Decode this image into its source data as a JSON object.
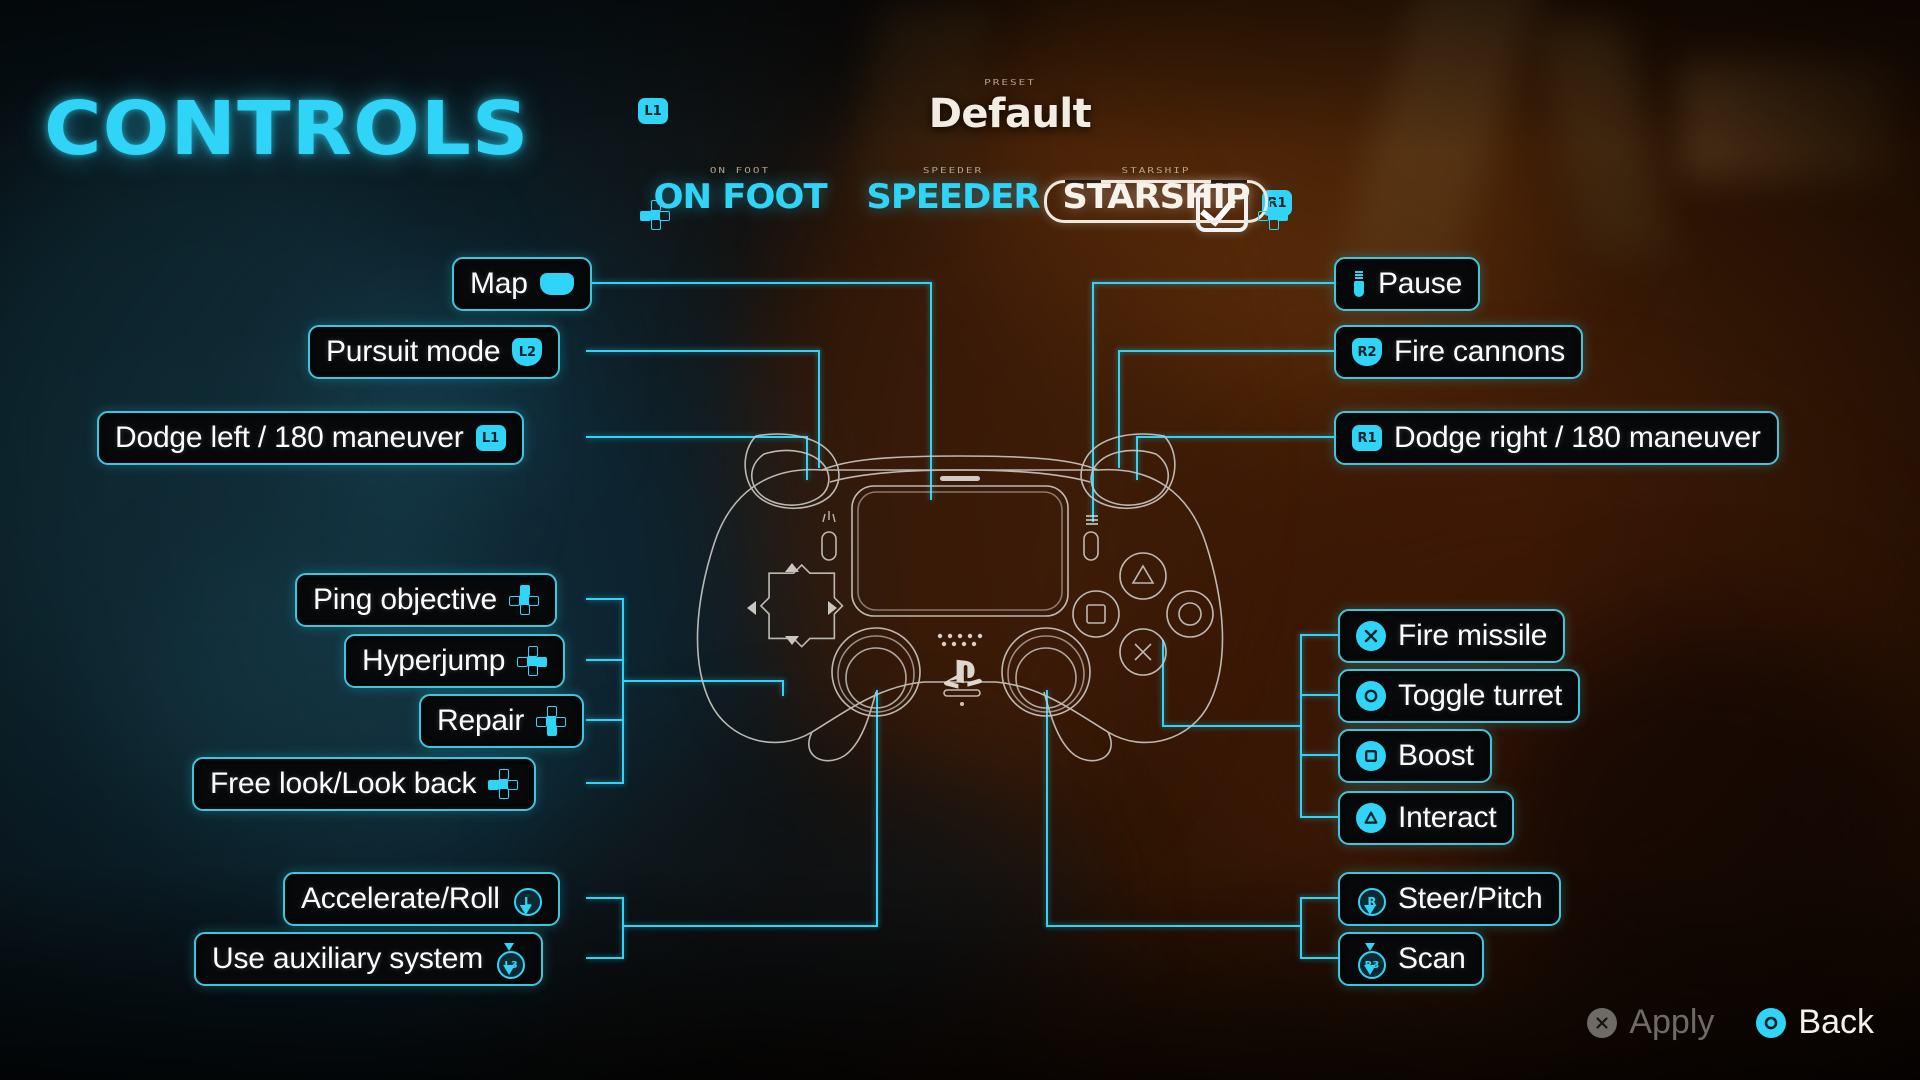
{
  "page": {
    "title": "CONTROLS",
    "accent_color": "#2fd4f7",
    "label_border_color": "#3fc6dd",
    "label_bg_color": "#07090b",
    "text_color": "#ffffff"
  },
  "header": {
    "prev_badge": "L1",
    "next_badge": "R1",
    "preset_caption": "PRESET",
    "preset_name": "Default",
    "confirm_icon": "checkbox-check-icon"
  },
  "tabs": {
    "dpad_left_icon": "dpad-left-icon",
    "dpad_right_icon": "dpad-right-icon",
    "items": [
      {
        "label": "ON FOOT",
        "caption": "ON FOOT",
        "selected": false
      },
      {
        "label": "SPEEDER",
        "caption": "SPEEDER",
        "selected": false
      },
      {
        "label": "STARSHIP",
        "caption": "STARSHIP",
        "selected": true
      }
    ]
  },
  "left_controls": [
    {
      "label": "Map",
      "icon": "touchpad-icon",
      "button": ""
    },
    {
      "label": "Pursuit mode",
      "icon": "trigger-icon",
      "button": "L2"
    },
    {
      "label": "Dodge left / 180 maneuver",
      "icon": "bumper-icon",
      "button": "L1"
    },
    {
      "label": "Ping objective",
      "icon": "dpad-up-icon",
      "button": ""
    },
    {
      "label": "Hyperjump",
      "icon": "dpad-right-icon",
      "button": ""
    },
    {
      "label": "Repair",
      "icon": "dpad-down-icon",
      "button": ""
    },
    {
      "label": "Free look/Look back",
      "icon": "dpad-left-icon",
      "button": ""
    },
    {
      "label": "Accelerate/Roll",
      "icon": "left-stick-icon",
      "button": "L"
    },
    {
      "label": "Use auxiliary system",
      "icon": "left-stick-press-icon",
      "button": "L3"
    }
  ],
  "right_controls": [
    {
      "label": "Pause",
      "icon": "options-icon",
      "button": ""
    },
    {
      "label": "Fire cannons",
      "icon": "trigger-icon",
      "button": "R2"
    },
    {
      "label": "Dodge right / 180 maneuver",
      "icon": "bumper-icon",
      "button": "R1"
    },
    {
      "label": "Fire missile",
      "icon": "cross-icon",
      "button": ""
    },
    {
      "label": "Toggle turret",
      "icon": "circle-icon",
      "button": ""
    },
    {
      "label": "Boost",
      "icon": "square-icon",
      "button": ""
    },
    {
      "label": "Interact",
      "icon": "triangle-icon",
      "button": ""
    },
    {
      "label": "Steer/Pitch",
      "icon": "right-stick-icon",
      "button": "R"
    },
    {
      "label": "Scan",
      "icon": "right-stick-press-icon",
      "button": "R3"
    }
  ],
  "footer": {
    "apply_label": "Apply",
    "apply_icon": "cross-icon",
    "apply_enabled": false,
    "back_label": "Back",
    "back_icon": "circle-icon",
    "back_enabled": true
  }
}
